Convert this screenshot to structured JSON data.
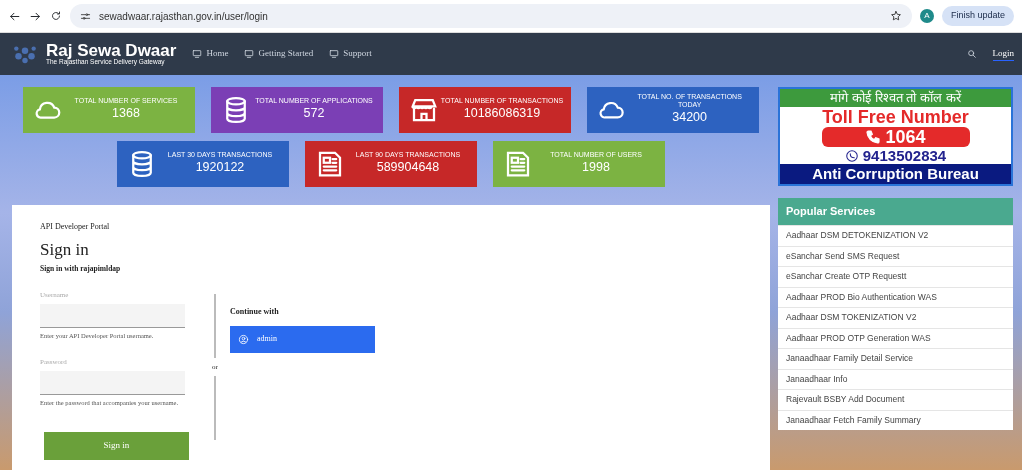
{
  "browser": {
    "url": "sewadwaar.rajasthan.gov.in/user/login",
    "profile_initial": "A",
    "update_button": "Finish update"
  },
  "navbar": {
    "brand": "Raj Sewa Dwaar",
    "tagline": "The Rajasthan Service Delivery Gateway",
    "links": [
      "Home",
      "Getting Started",
      "Support"
    ],
    "login": "Login"
  },
  "stats": [
    {
      "kind": "cloud",
      "color": "#7cb342",
      "label": "TOTAL NUMBER OF SERVICES",
      "value": "1368"
    },
    {
      "kind": "database",
      "color": "#7b3fb5",
      "label": "TOTAL NUMBER OF APPLICATIONS",
      "value": "572"
    },
    {
      "kind": "store",
      "color": "#c62828",
      "label": "TOTAL NUMBER OF TRANSACTIONS",
      "value": "10186086319"
    },
    {
      "kind": "cloud",
      "color": "#2d62c0",
      "label": "TOTAL NO. OF TRANSACTIONS TODAY",
      "value": "34200"
    },
    {
      "kind": "database",
      "color": "#2d62c0",
      "label": "LAST 30 DAYS TRANSACTIONS",
      "value": "1920122"
    },
    {
      "kind": "document",
      "color": "#c62828",
      "label": "LAST 90 DAYS TRANSACTIONS",
      "value": "589904648"
    },
    {
      "kind": "document",
      "color": "#7cb342",
      "label": "TOTAL NUMBER OF USERS",
      "value": "1998"
    }
  ],
  "signin": {
    "portal": "API Developer Portal",
    "title": "Sign in",
    "subtitle": "Sign in with rajapimldap",
    "username_label": "Username",
    "username_help": "Enter your API Developer Portal username.",
    "password_label": "Password",
    "password_help": "Enter the password that accompanies your username.",
    "submit": "Sign in",
    "or": "or",
    "continue_with": "Continue with",
    "provider": "admin"
  },
  "banner": {
    "hindi": "मांगे कोई रिश्वत तो कॉल करें",
    "toll_free": "Toll Free Number",
    "number": "1064",
    "whatsapp": "9413502834",
    "bureau": "Anti Corruption Bureau"
  },
  "popular_services": {
    "title": "Popular Services",
    "items": [
      "Aadhaar DSM DETOKENIZATION V2",
      "eSanchar Send SMS Request",
      "eSanchar Create OTP Requestt",
      "Aadhaar PROD Bio Authentication WAS",
      "Aadhaar DSM TOKENIZATION V2",
      "Aadhaar PROD OTP Generation WAS",
      "Janaadhaar Family Detail Service",
      "Janaadhaar Info",
      "Rajevault BSBY Add Document",
      "Janaadhaar Fetch Family Summary"
    ]
  }
}
